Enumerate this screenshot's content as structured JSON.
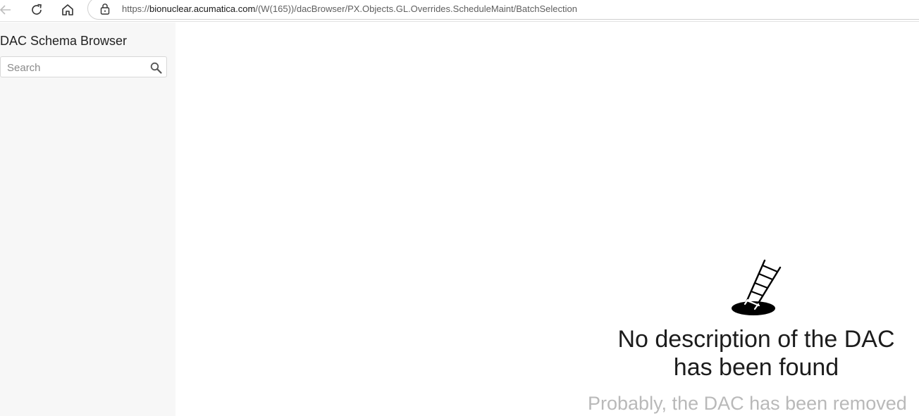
{
  "browser": {
    "url_prefix": "https://",
    "url_host": "bionuclear.acumatica.com",
    "url_path": "/(W(165))/dacBrowser/PX.Objects.GL.Overrides.ScheduleMaint/BatchSelection"
  },
  "sidebar": {
    "title": "DAC Schema Browser",
    "search_placeholder": "Search"
  },
  "empty_state": {
    "title": "No description of the DAC has been found",
    "subtitle": "Probably, the DAC has been removed"
  },
  "colors": {
    "sidebar_bg": "#f7f7f7",
    "subtitle": "#b9b9b9"
  }
}
